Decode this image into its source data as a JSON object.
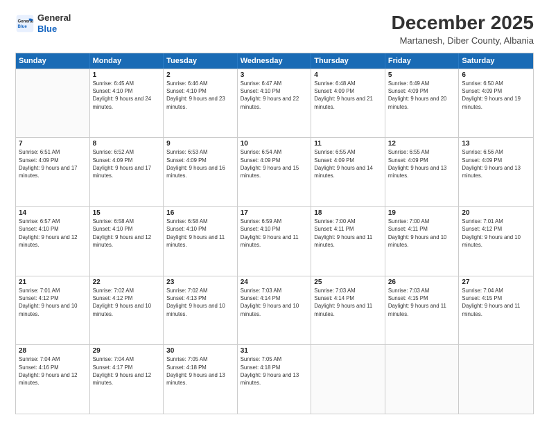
{
  "logo": {
    "line1": "General",
    "line2": "Blue"
  },
  "title": "December 2025",
  "subtitle": "Martanesh, Diber County, Albania",
  "header": {
    "days": [
      "Sunday",
      "Monday",
      "Tuesday",
      "Wednesday",
      "Thursday",
      "Friday",
      "Saturday"
    ]
  },
  "rows": [
    [
      {
        "day": "",
        "empty": true
      },
      {
        "day": "1",
        "sunrise": "6:45 AM",
        "sunset": "4:10 PM",
        "daylight": "9 hours and 24 minutes."
      },
      {
        "day": "2",
        "sunrise": "6:46 AM",
        "sunset": "4:10 PM",
        "daylight": "9 hours and 23 minutes."
      },
      {
        "day": "3",
        "sunrise": "6:47 AM",
        "sunset": "4:10 PM",
        "daylight": "9 hours and 22 minutes."
      },
      {
        "day": "4",
        "sunrise": "6:48 AM",
        "sunset": "4:09 PM",
        "daylight": "9 hours and 21 minutes."
      },
      {
        "day": "5",
        "sunrise": "6:49 AM",
        "sunset": "4:09 PM",
        "daylight": "9 hours and 20 minutes."
      },
      {
        "day": "6",
        "sunrise": "6:50 AM",
        "sunset": "4:09 PM",
        "daylight": "9 hours and 19 minutes."
      }
    ],
    [
      {
        "day": "7",
        "sunrise": "6:51 AM",
        "sunset": "4:09 PM",
        "daylight": "9 hours and 17 minutes."
      },
      {
        "day": "8",
        "sunrise": "6:52 AM",
        "sunset": "4:09 PM",
        "daylight": "9 hours and 17 minutes."
      },
      {
        "day": "9",
        "sunrise": "6:53 AM",
        "sunset": "4:09 PM",
        "daylight": "9 hours and 16 minutes."
      },
      {
        "day": "10",
        "sunrise": "6:54 AM",
        "sunset": "4:09 PM",
        "daylight": "9 hours and 15 minutes."
      },
      {
        "day": "11",
        "sunrise": "6:55 AM",
        "sunset": "4:09 PM",
        "daylight": "9 hours and 14 minutes."
      },
      {
        "day": "12",
        "sunrise": "6:55 AM",
        "sunset": "4:09 PM",
        "daylight": "9 hours and 13 minutes."
      },
      {
        "day": "13",
        "sunrise": "6:56 AM",
        "sunset": "4:09 PM",
        "daylight": "9 hours and 13 minutes."
      }
    ],
    [
      {
        "day": "14",
        "sunrise": "6:57 AM",
        "sunset": "4:10 PM",
        "daylight": "9 hours and 12 minutes."
      },
      {
        "day": "15",
        "sunrise": "6:58 AM",
        "sunset": "4:10 PM",
        "daylight": "9 hours and 12 minutes."
      },
      {
        "day": "16",
        "sunrise": "6:58 AM",
        "sunset": "4:10 PM",
        "daylight": "9 hours and 11 minutes."
      },
      {
        "day": "17",
        "sunrise": "6:59 AM",
        "sunset": "4:10 PM",
        "daylight": "9 hours and 11 minutes."
      },
      {
        "day": "18",
        "sunrise": "7:00 AM",
        "sunset": "4:11 PM",
        "daylight": "9 hours and 11 minutes."
      },
      {
        "day": "19",
        "sunrise": "7:00 AM",
        "sunset": "4:11 PM",
        "daylight": "9 hours and 10 minutes."
      },
      {
        "day": "20",
        "sunrise": "7:01 AM",
        "sunset": "4:12 PM",
        "daylight": "9 hours and 10 minutes."
      }
    ],
    [
      {
        "day": "21",
        "sunrise": "7:01 AM",
        "sunset": "4:12 PM",
        "daylight": "9 hours and 10 minutes."
      },
      {
        "day": "22",
        "sunrise": "7:02 AM",
        "sunset": "4:12 PM",
        "daylight": "9 hours and 10 minutes."
      },
      {
        "day": "23",
        "sunrise": "7:02 AM",
        "sunset": "4:13 PM",
        "daylight": "9 hours and 10 minutes."
      },
      {
        "day": "24",
        "sunrise": "7:03 AM",
        "sunset": "4:14 PM",
        "daylight": "9 hours and 10 minutes."
      },
      {
        "day": "25",
        "sunrise": "7:03 AM",
        "sunset": "4:14 PM",
        "daylight": "9 hours and 11 minutes."
      },
      {
        "day": "26",
        "sunrise": "7:03 AM",
        "sunset": "4:15 PM",
        "daylight": "9 hours and 11 minutes."
      },
      {
        "day": "27",
        "sunrise": "7:04 AM",
        "sunset": "4:15 PM",
        "daylight": "9 hours and 11 minutes."
      }
    ],
    [
      {
        "day": "28",
        "sunrise": "7:04 AM",
        "sunset": "4:16 PM",
        "daylight": "9 hours and 12 minutes."
      },
      {
        "day": "29",
        "sunrise": "7:04 AM",
        "sunset": "4:17 PM",
        "daylight": "9 hours and 12 minutes."
      },
      {
        "day": "30",
        "sunrise": "7:05 AM",
        "sunset": "4:18 PM",
        "daylight": "9 hours and 13 minutes."
      },
      {
        "day": "31",
        "sunrise": "7:05 AM",
        "sunset": "4:18 PM",
        "daylight": "9 hours and 13 minutes."
      },
      {
        "day": "",
        "empty": true
      },
      {
        "day": "",
        "empty": true
      },
      {
        "day": "",
        "empty": true
      }
    ]
  ]
}
